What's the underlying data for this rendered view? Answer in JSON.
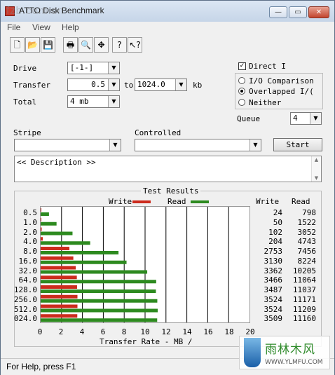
{
  "window": {
    "title": "ATTO Disk Benchmark",
    "watermark": "fzb.com.cn"
  },
  "caption_buttons": [
    "—",
    "▭",
    "✕"
  ],
  "menu": [
    "File",
    "View",
    "Help"
  ],
  "toolbar_icons": [
    "new-file-icon",
    "open-folder-icon",
    "save-icon",
    "print-icon",
    "print-preview-icon",
    "move-icon",
    "help-icon",
    "context-help-icon"
  ],
  "toolbar_glyphs": [
    "🗋",
    "📂",
    "💾",
    "🖶",
    "🔍",
    "✥",
    "?",
    "↖?"
  ],
  "drive": {
    "label": "Drive",
    "value": "[-1-]"
  },
  "transfer": {
    "label": "Transfer",
    "from": "0.5",
    "to_label": "to",
    "to": "1024.0",
    "unit": "kb"
  },
  "total": {
    "label": "Total",
    "value": "4 mb"
  },
  "direct_io": {
    "label": "Direct I",
    "checked": true
  },
  "io_modes": [
    {
      "label": "I/O Comparison",
      "selected": false
    },
    {
      "label": "Overlapped I/(",
      "selected": true
    },
    {
      "label": "Neither",
      "selected": false
    }
  ],
  "queue": {
    "label": "Queue",
    "value": "4"
  },
  "stripe": {
    "label": "Stripe",
    "value": ""
  },
  "controlled": {
    "label": "Controlled",
    "value": ""
  },
  "start_label": "Start",
  "description": "<< Description >>",
  "results": {
    "title": "Test Results",
    "legend_write": "Write",
    "legend_read": "Read",
    "col_write": "Write",
    "col_read": "Read",
    "xlabel": "Transfer Rate - MB /",
    "write_color": "#cc2b1d",
    "read_color": "#2d8a1f"
  },
  "chart_data": {
    "type": "bar",
    "categories": [
      "0.5",
      "1.0",
      "2.0",
      "4.0",
      "8.0",
      "16.0",
      "32.0",
      "64.0",
      "128.0",
      "256.0",
      "512.0",
      "024.0"
    ],
    "series": [
      {
        "name": "Write",
        "values": [
          24,
          50,
          102,
          204,
          2753,
          3130,
          3362,
          3466,
          3487,
          3524,
          3524,
          3509
        ]
      },
      {
        "name": "Read",
        "values": [
          798,
          1522,
          3052,
          4743,
          7456,
          8224,
          10205,
          11064,
          11037,
          11171,
          11209,
          11160
        ]
      }
    ],
    "xticks": [
      "0",
      "2",
      "4",
      "6",
      "8",
      "10",
      "12",
      "14",
      "16",
      "18",
      "20"
    ],
    "xlim": [
      0,
      20
    ],
    "xlabel": "Transfer Rate - MB /",
    "grid": true
  },
  "status": "For Help, press F1",
  "site_watermark": {
    "text": "雨林木风",
    "url": "WWW.YLMFU.COM"
  }
}
